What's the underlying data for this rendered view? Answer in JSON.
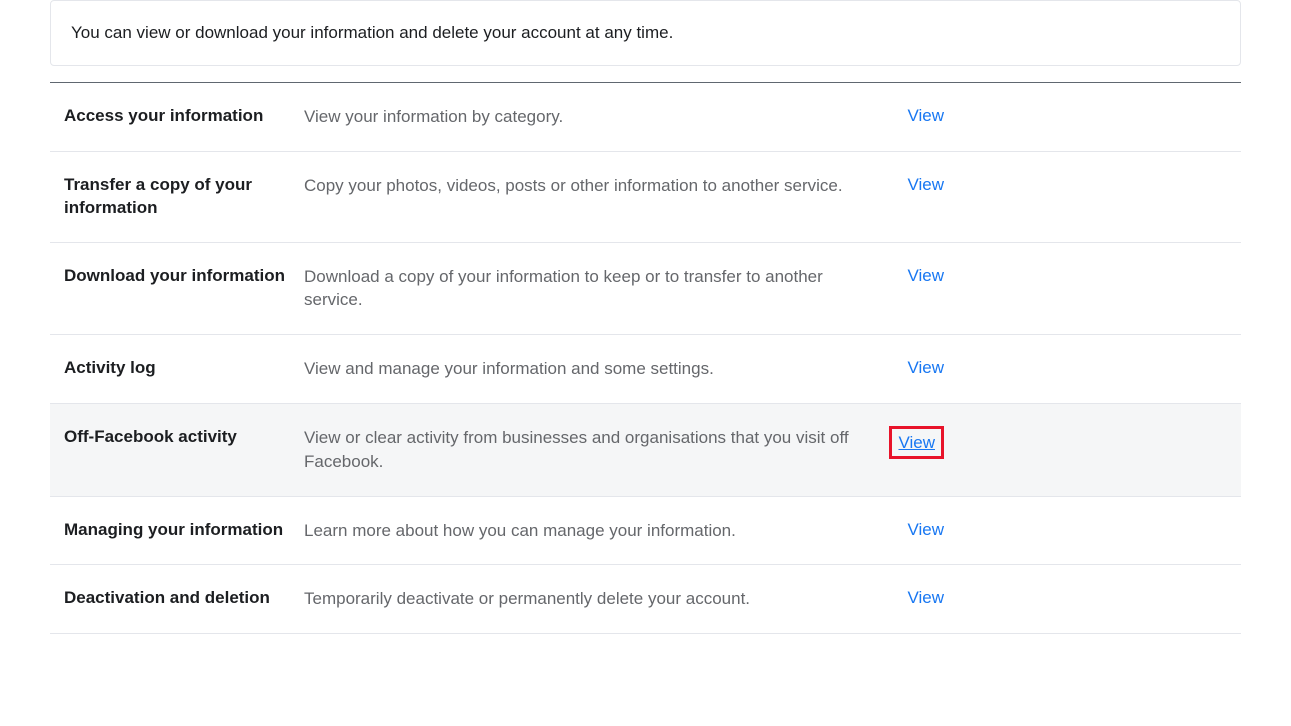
{
  "banner": {
    "text": "You can view or download your information and delete your account at any time."
  },
  "rows": [
    {
      "title": "Access your information",
      "desc": "View your information by category.",
      "action": "View"
    },
    {
      "title": "Transfer a copy of your information",
      "desc": "Copy your photos, videos, posts or other information to another service.",
      "action": "View"
    },
    {
      "title": "Download your information",
      "desc": "Download a copy of your information to keep or to transfer to another service.",
      "action": "View"
    },
    {
      "title": "Activity log",
      "desc": "View and manage your information and some settings.",
      "action": "View"
    },
    {
      "title": "Off-Facebook activity",
      "desc": "View or clear activity from businesses and organisations that you visit off Facebook.",
      "action": "View"
    },
    {
      "title": "Managing your information",
      "desc": "Learn more about how you can manage your information.",
      "action": "View"
    },
    {
      "title": "Deactivation and deletion",
      "desc": "Temporarily deactivate or permanently delete your account.",
      "action": "View"
    }
  ]
}
